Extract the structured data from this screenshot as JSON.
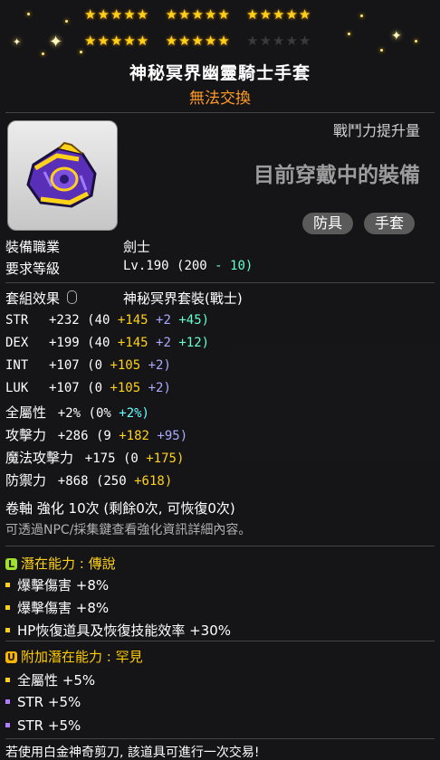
{
  "stars": {
    "row1_filled": 15,
    "row2_filled": 10,
    "row2_empty": 5
  },
  "item": {
    "name": "神秘冥界幽靈騎士手套",
    "trade_status": "無法交換",
    "combat_label": "戰鬥力提升量",
    "equipped_text": "目前穿戴中的裝備",
    "tags": [
      "防具",
      "手套"
    ]
  },
  "requirements": {
    "job_label": "裝備職業",
    "job_value": "劍士",
    "level_label": "要求等級",
    "level_value": "Lv.190",
    "level_base": "(200",
    "level_minus": "- 10)"
  },
  "set": {
    "label": "套組效果",
    "name": "神秘冥界套裝(戰士)"
  },
  "stats": [
    {
      "name": "STR",
      "total": "+232",
      "base": "(40",
      "add1": "+145",
      "add2": "+2",
      "add3": "+45)"
    },
    {
      "name": "DEX",
      "total": "+199",
      "base": "(40",
      "add1": "+145",
      "add2": "+2",
      "add3": "+12)"
    },
    {
      "name": "INT",
      "total": "+107",
      "base": "(0",
      "add1": "+105",
      "add2": "+2)",
      "add3": ""
    },
    {
      "name": "LUK",
      "total": "+107",
      "base": "(0",
      "add1": "+105",
      "add2": "+2)",
      "add3": ""
    }
  ],
  "stats2": [
    {
      "name": "全屬性",
      "total": "+2%",
      "base": "(0%",
      "add": "+2%)",
      "add_color": "c"
    },
    {
      "name": "攻擊力",
      "total": "+286",
      "base": "(9",
      "add1": "+182",
      "add2": "+95)"
    },
    {
      "name": "魔法攻擊力",
      "total": "+175",
      "base": "(0",
      "add1": "+175)",
      "add2": ""
    },
    {
      "name": "防禦力",
      "total": "+868",
      "base": "(250",
      "add1": "+618)",
      "add2": ""
    }
  ],
  "scroll": {
    "line": "卷軸 強化 10次 (剩餘0次, 可恢復0次)",
    "hint": "可透過NPC/採集鍵查看強化資訊詳細內容。"
  },
  "potential": {
    "header": "潛在能力 : 傳說",
    "lines": [
      "爆擊傷害 +8%",
      "爆擊傷害 +8%",
      "HP恢復道具及恢復技能效率 +30%"
    ]
  },
  "additional": {
    "header": "附加潛在能力 : 罕見",
    "lines": [
      "全屬性 +5%",
      "STR +5%",
      "STR +5%"
    ]
  },
  "footer": "若使用白金神奇剪刀, 該道具可進行一次交易!",
  "colors": {
    "star": "#ffd21a",
    "unique": "#ffcc00",
    "legendary_badge": "#9ee02b",
    "trade": "#ff9a26"
  }
}
